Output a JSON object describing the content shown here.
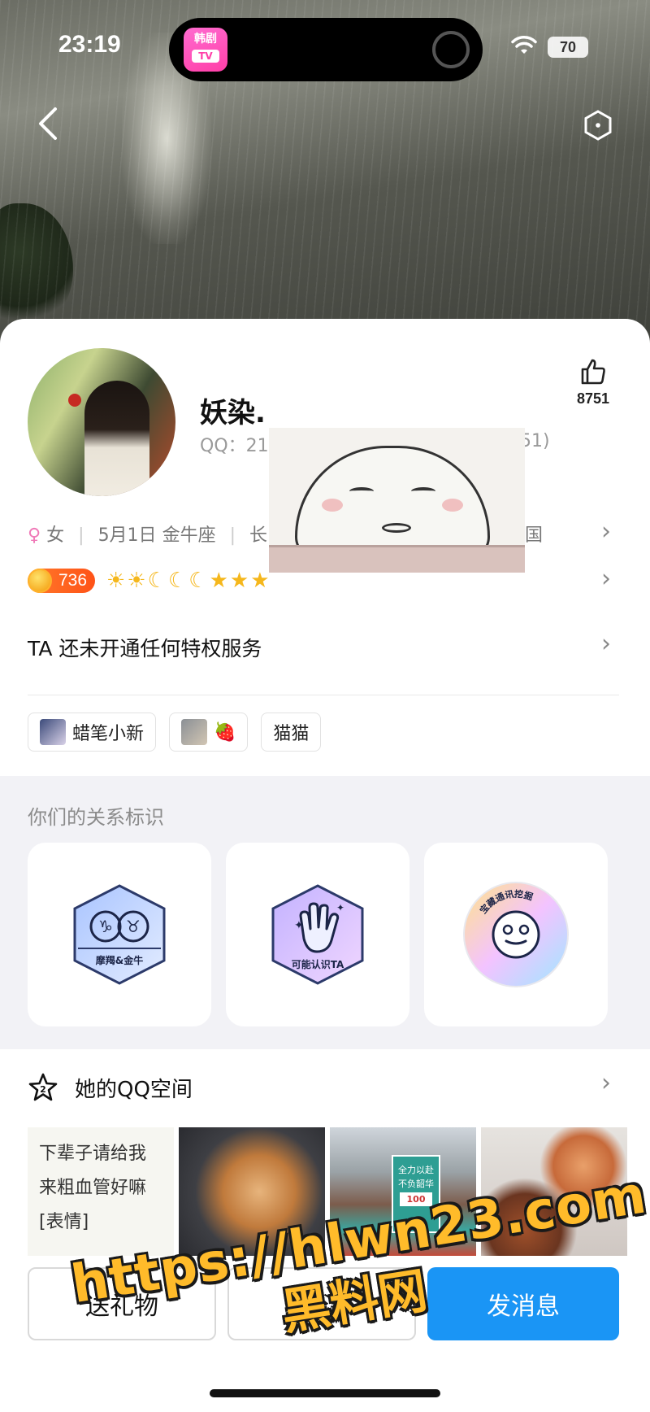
{
  "status_bar": {
    "time": "23:19",
    "battery": "70"
  },
  "dynamic_island": {
    "app_icon_line1": "韩剧",
    "app_icon_line2": "TV"
  },
  "profile": {
    "nickname": "妖染.",
    "qq_prefix": "QQ：21",
    "qq_suffix": "51)",
    "likes": "8751",
    "gender_symbol": "♀",
    "gender": "女",
    "birthday": "5月1日",
    "zodiac": "金牛座",
    "location_prefix": "长",
    "country_suffix": "国",
    "level_number": "736",
    "level_icons": "☀☀☾☾☾★★★"
  },
  "privilege_text": "TA 还未开通任何特权服务",
  "tags": [
    {
      "label": "蜡笔小新"
    },
    {
      "label": "🍓"
    },
    {
      "label": "猫猫"
    }
  ],
  "relationship": {
    "title": "你们的关系标识",
    "cards": [
      {
        "label": "摩羯&金牛",
        "sym_left": "♑",
        "sym_right": "♉"
      },
      {
        "label": "可能认识TA"
      },
      {
        "label": "宝藏通讯挖掘"
      }
    ]
  },
  "qzone": {
    "title": "她的QQ空间",
    "text_preview": [
      "下辈子请给我",
      "来粗血管好嘛",
      "[表情]"
    ],
    "photo2_sign": [
      "全力以赴",
      "不负韶华",
      "100"
    ]
  },
  "actions": {
    "gift": "送礼物",
    "follow": "关注",
    "message": "发消息"
  },
  "watermark": {
    "url": "https://hlwn23.com",
    "site": "黑料网"
  },
  "colors": {
    "accent_blue": "#1a95f5",
    "level_orange": "#ff5a1f",
    "watermark_yellow": "#ffbb2a"
  }
}
